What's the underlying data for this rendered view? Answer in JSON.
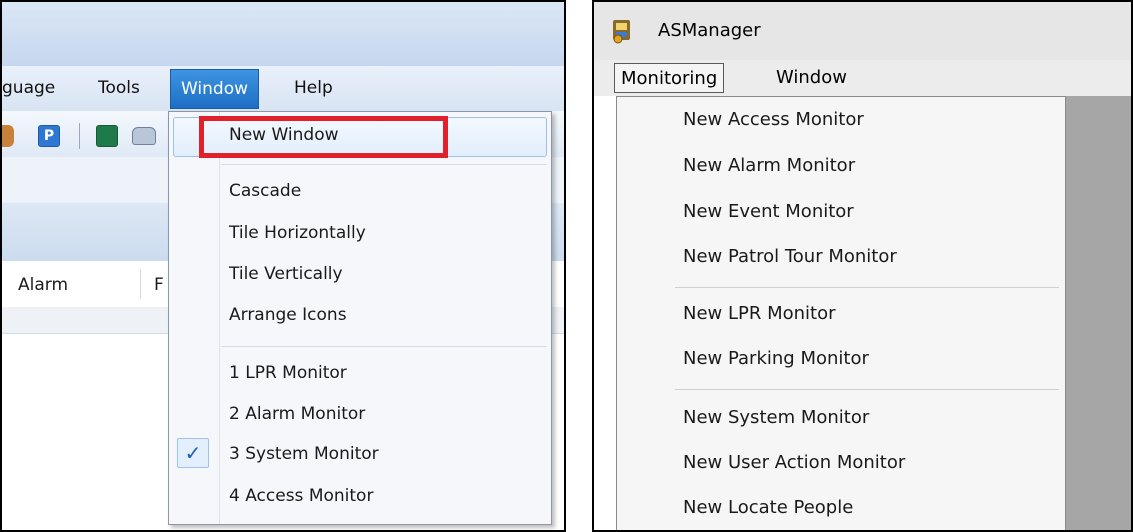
{
  "left_window": {
    "menubar": [
      "guage",
      "Tools",
      "Window",
      "Help"
    ],
    "columns": [
      "Alarm",
      "F"
    ],
    "window_menu": {
      "items": [
        "New Window",
        "Cascade",
        "Tile Horizontally",
        "Tile Vertically",
        "Arrange Icons",
        "1 LPR Monitor",
        "2 Alarm Monitor",
        "3 System Monitor",
        "4 Access Monitor"
      ],
      "checked_item": "3 System Monitor",
      "check_glyph": "✓",
      "highlight_color": "#e0202a"
    }
  },
  "right_window": {
    "title": "ASManager",
    "menubar": [
      "Monitoring",
      "Window"
    ],
    "monitoring_menu": {
      "items": [
        "New Access Monitor",
        "New Alarm Monitor",
        "New Event Monitor",
        "New Patrol Tour Monitor",
        "New LPR Monitor",
        "New Parking Monitor",
        "New System Monitor",
        "New User Action Monitor",
        "New Locate People"
      ]
    }
  }
}
